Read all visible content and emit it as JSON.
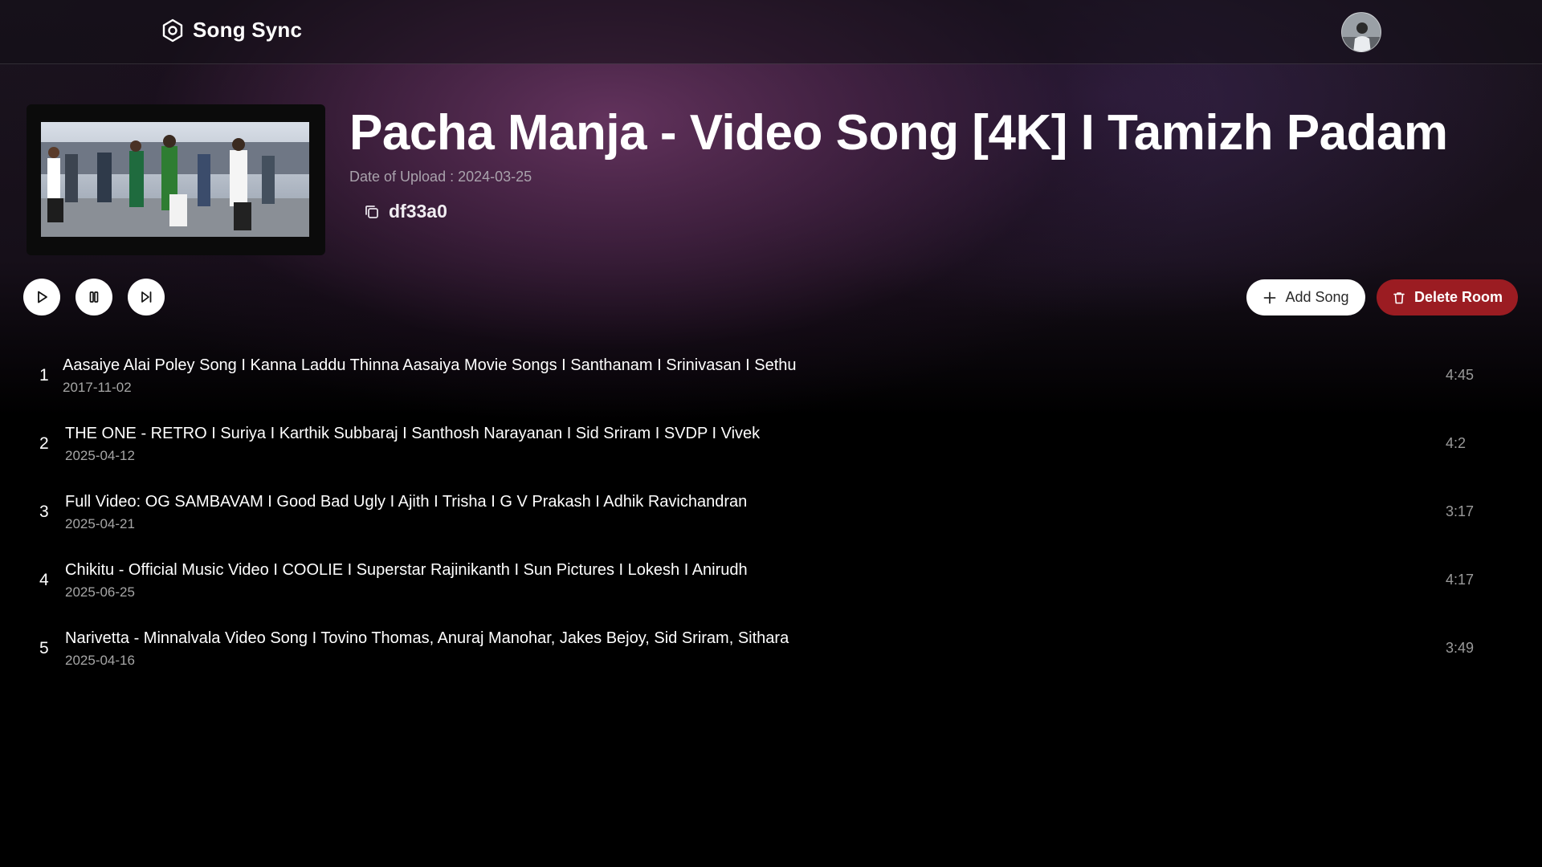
{
  "app": {
    "name": "Song Sync"
  },
  "now_playing": {
    "title": "Pacha Manja - Video Song [4K] I Tamizh Padam",
    "upload_label": "Date of Upload : 2024-03-25",
    "room_code": "df33a0"
  },
  "controls": {
    "play_icon": "play-icon",
    "pause_icon": "pause-icon",
    "next_icon": "skip-next-icon"
  },
  "actions": {
    "add_song_label": "Add Song",
    "delete_room_label": "Delete Room",
    "delete_color": "#9b1c22"
  },
  "songs": [
    {
      "index": "1",
      "title": "Aasaiye Alai Poley Song I Kanna Laddu Thinna Aasaiya Movie Songs I Santhanam I Srinivasan I Sethu",
      "date": "2017-11-02",
      "duration": "4:45"
    },
    {
      "index": "2",
      "title": "THE ONE - RETRO I Suriya I Karthik Subbaraj I Santhosh Narayanan I Sid Sriram I SVDP I Vivek",
      "date": "2025-04-12",
      "duration": "4:2"
    },
    {
      "index": "3",
      "title": "Full Video: OG SAMBAVAM I Good Bad Ugly I Ajith I Trisha I G V Prakash I Adhik Ravichandran",
      "date": "2025-04-21",
      "duration": "3:17"
    },
    {
      "index": "4",
      "title": "Chikitu - Official Music Video I COOLIE I Superstar Rajinikanth I Sun Pictures I Lokesh I Anirudh",
      "date": "2025-06-25",
      "duration": "4:17"
    },
    {
      "index": "5",
      "title": "Narivetta - Minnalvala Video Song I Tovino Thomas, Anuraj Manohar, Jakes Bejoy, Sid Sriram, Sithara",
      "date": "2025-04-16",
      "duration": "3:49"
    }
  ]
}
